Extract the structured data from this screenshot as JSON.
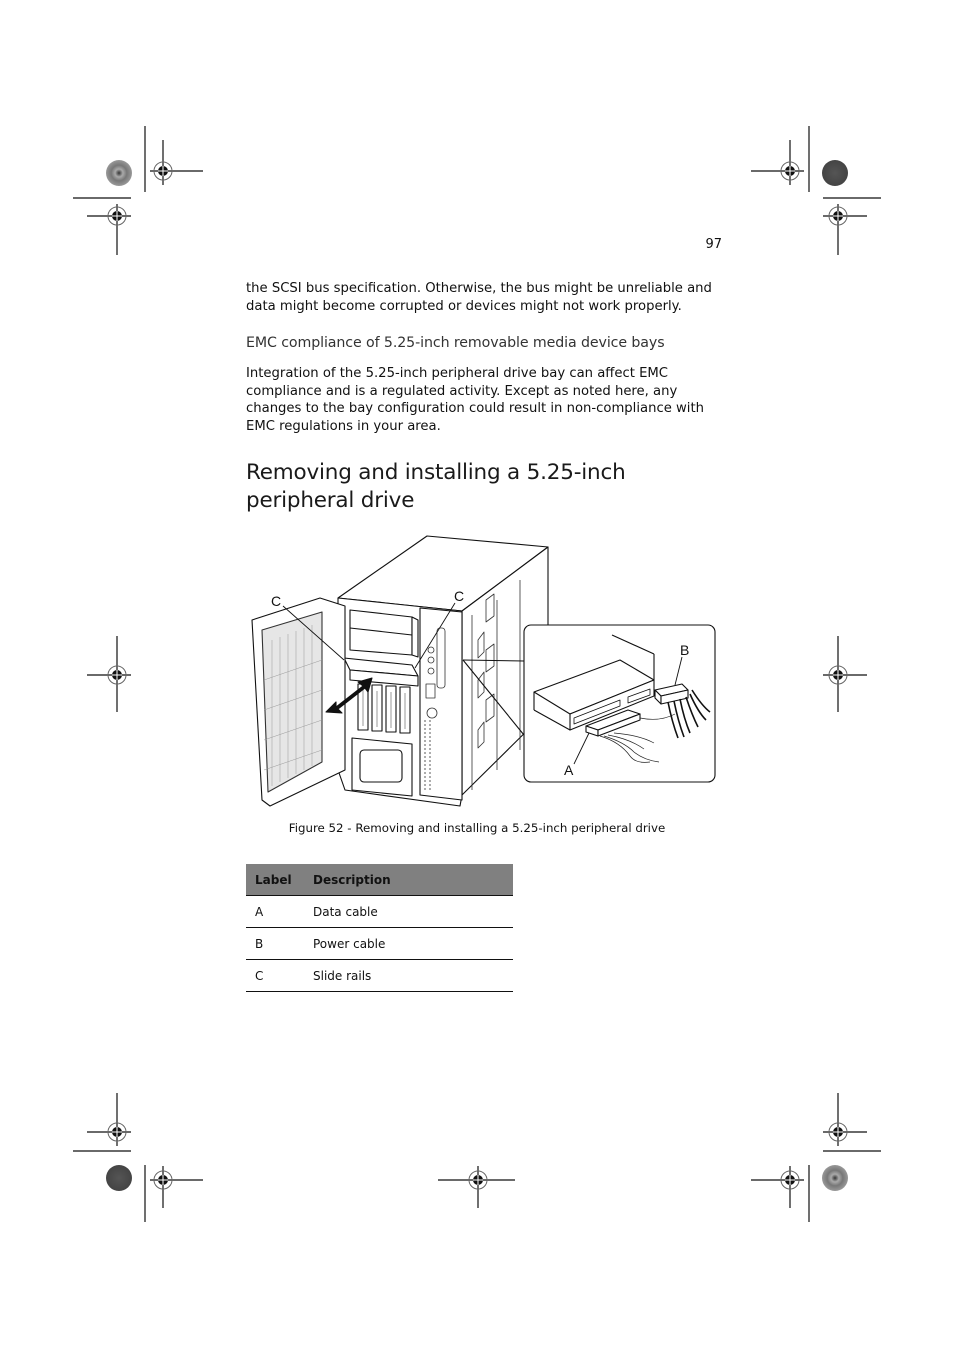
{
  "page": {
    "number": "97"
  },
  "body": {
    "paragraph_1": "the SCSI bus specification.  Otherwise, the bus might be unreliable and data might become corrupted or devices might not work properly.",
    "subheading": "EMC compliance of 5.25-inch removable media device bays",
    "paragraph_2": "Integration of the 5.25-inch peripheral drive bay can affect EMC compliance and is a regulated activity.  Except as noted here, any changes to the bay configuration could result in non-compliance with EMC regulations in your area.",
    "section_title_line1": "Removing and installing a 5.25-inch",
    "section_title_line2": "peripheral drive"
  },
  "figure": {
    "callouts": {
      "c_left": "C",
      "c_right": "C",
      "a": "A",
      "b": "B"
    },
    "caption": "Figure 52 - Removing and installing a 5.25-inch peripheral drive"
  },
  "legend_table": {
    "headers": [
      "Label",
      "Description"
    ],
    "rows": [
      [
        "A",
        "Data cable"
      ],
      [
        "B",
        "Power cable"
      ],
      [
        "C",
        "Slide rails"
      ]
    ]
  }
}
